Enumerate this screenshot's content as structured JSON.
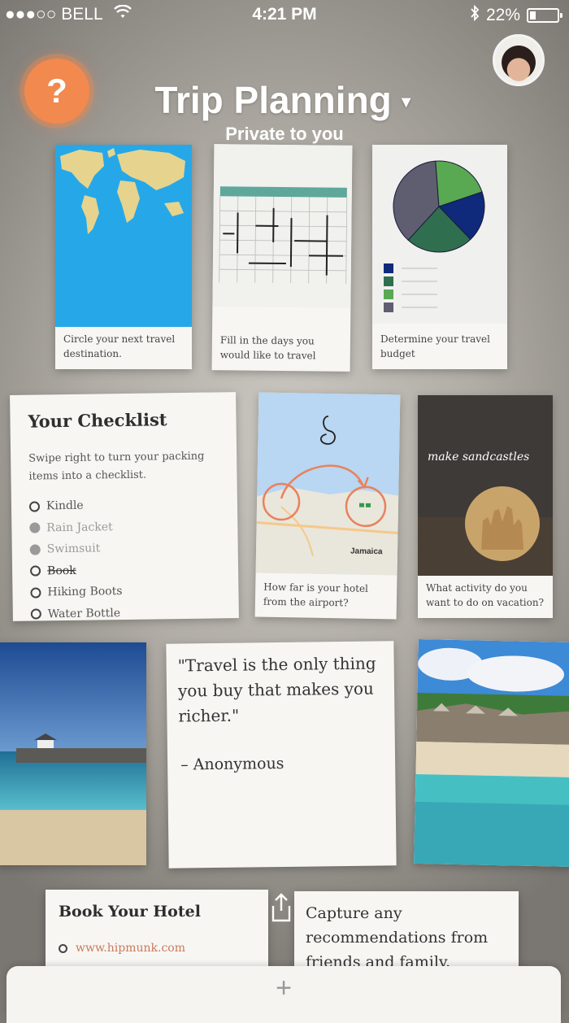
{
  "status_bar": {
    "carrier": "●●●○○ BELL",
    "time": "4:21 PM",
    "battery": "22%",
    "battery_level": 0.22
  },
  "header": {
    "help_label": "?",
    "title": "Trip Planning",
    "subtitle": "Private to you"
  },
  "cards": {
    "map": {
      "caption": "Circle your next travel destination."
    },
    "calendar": {
      "caption": "Fill in the days you would like to travel"
    },
    "budget": {
      "caption": "Determine your travel budget",
      "slices": [
        {
          "color": "#5f5d70",
          "value": 37
        },
        {
          "color": "#59a852",
          "value": 21
        },
        {
          "color": "#0f2a7a",
          "value": 18
        },
        {
          "color": "#2f6f4f",
          "value": 24
        }
      ]
    },
    "checklist": {
      "title": "Your Checklist",
      "instructions": "Swipe right to turn your packing items into a checklist.",
      "items": [
        {
          "label": "Kindle",
          "state": "open"
        },
        {
          "label": "Rain Jacket",
          "state": "checked"
        },
        {
          "label": "Swimsuit",
          "state": "checked"
        },
        {
          "label": "Book",
          "state": "struck"
        },
        {
          "label": "Hiking Boots",
          "state": "open"
        },
        {
          "label": "Water Bottle",
          "state": "open"
        }
      ]
    },
    "airport_map": {
      "caption": "How far is your hotel from the airport?",
      "map_label": "Jamaica"
    },
    "sandcastle": {
      "caption": "What activity do you want to do on vacation?",
      "overlay": "make sandcastles"
    },
    "quote": {
      "text": "\"Travel is the only thing you buy that makes you richer.\"",
      "author": "– Anonymous"
    },
    "hotel": {
      "title": "Book Your Hotel",
      "link": "www.hipmunk.com"
    },
    "recommendations": {
      "text": "Capture any recommendations from friends and family."
    }
  },
  "bottom_bar": {
    "add_label": "+"
  }
}
